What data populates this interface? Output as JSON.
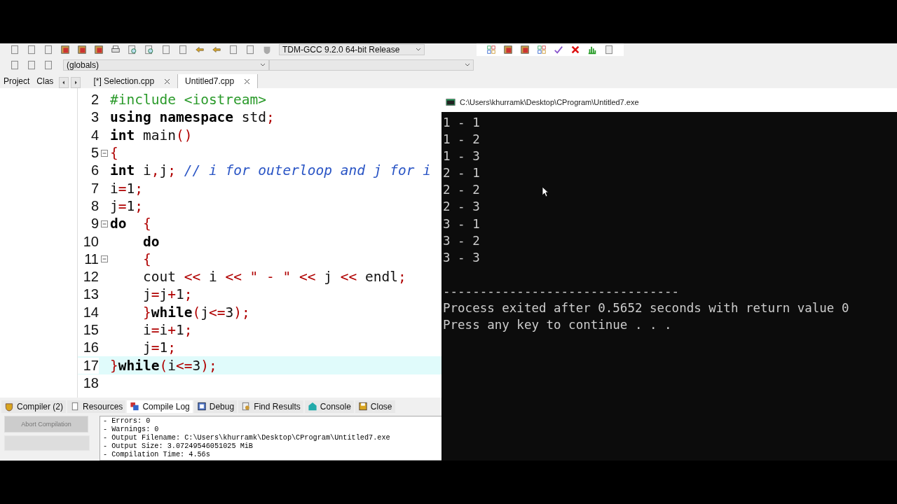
{
  "toolbar": {
    "compiler": "TDM-GCC 9.2.0 64-bit Release",
    "scope": "(globals)"
  },
  "side_tabs": [
    {
      "label": "Project"
    },
    {
      "label": "Clas"
    }
  ],
  "editor_tabs": [
    {
      "label": "[*] Selection.cpp",
      "selected": false
    },
    {
      "label": "Untitled7.cpp",
      "selected": true
    }
  ],
  "editor": {
    "lines": [
      {
        "number": "2",
        "fold": false,
        "highlighted": false,
        "tokens": [
          {
            "kind": "preproc",
            "text": "#include <iostream>"
          }
        ]
      },
      {
        "number": "3",
        "fold": false,
        "highlighted": false,
        "tokens": [
          {
            "kind": "keyword",
            "text": "using namespace"
          },
          {
            "kind": "plain",
            "text": " std"
          },
          {
            "kind": "symbol",
            "text": ";"
          }
        ]
      },
      {
        "number": "4",
        "fold": false,
        "highlighted": false,
        "tokens": [
          {
            "kind": "keyword",
            "text": "int"
          },
          {
            "kind": "plain",
            "text": " main"
          },
          {
            "kind": "symbol",
            "text": "()"
          }
        ]
      },
      {
        "number": "5",
        "fold": true,
        "highlighted": false,
        "tokens": [
          {
            "kind": "symbol",
            "text": "{"
          }
        ]
      },
      {
        "number": "6",
        "fold": false,
        "highlighted": false,
        "tokens": [
          {
            "kind": "keyword",
            "text": "int"
          },
          {
            "kind": "plain",
            "text": " i"
          },
          {
            "kind": "symbol",
            "text": ","
          },
          {
            "kind": "plain",
            "text": "j"
          },
          {
            "kind": "symbol",
            "text": "; "
          },
          {
            "kind": "comment",
            "text": "// i for outerloop and j for i"
          }
        ]
      },
      {
        "number": "7",
        "fold": false,
        "highlighted": false,
        "tokens": [
          {
            "kind": "plain",
            "text": "i"
          },
          {
            "kind": "symbol",
            "text": "="
          },
          {
            "kind": "plain",
            "text": "1"
          },
          {
            "kind": "symbol",
            "text": ";"
          }
        ]
      },
      {
        "number": "8",
        "fold": false,
        "highlighted": false,
        "tokens": [
          {
            "kind": "plain",
            "text": "j"
          },
          {
            "kind": "symbol",
            "text": "="
          },
          {
            "kind": "plain",
            "text": "1"
          },
          {
            "kind": "symbol",
            "text": ";"
          }
        ]
      },
      {
        "number": "9",
        "fold": true,
        "highlighted": false,
        "tokens": [
          {
            "kind": "keyword",
            "text": "do"
          },
          {
            "kind": "symbol",
            "text": "  {"
          }
        ]
      },
      {
        "number": "10",
        "fold": false,
        "highlighted": false,
        "tokens": [
          {
            "kind": "keyword",
            "text": "    do"
          }
        ]
      },
      {
        "number": "11",
        "fold": true,
        "highlighted": false,
        "tokens": [
          {
            "kind": "symbol",
            "text": "    {"
          }
        ]
      },
      {
        "number": "12",
        "fold": false,
        "highlighted": false,
        "tokens": [
          {
            "kind": "plain",
            "text": "    cout "
          },
          {
            "kind": "symbol",
            "text": "<<"
          },
          {
            "kind": "plain",
            "text": " i "
          },
          {
            "kind": "symbol",
            "text": "<< \" - \" <<"
          },
          {
            "kind": "plain",
            "text": " j "
          },
          {
            "kind": "symbol",
            "text": "<<"
          },
          {
            "kind": "plain",
            "text": " endl"
          },
          {
            "kind": "symbol",
            "text": ";"
          }
        ]
      },
      {
        "number": "13",
        "fold": false,
        "highlighted": false,
        "tokens": [
          {
            "kind": "plain",
            "text": "    j"
          },
          {
            "kind": "symbol",
            "text": "="
          },
          {
            "kind": "plain",
            "text": "j"
          },
          {
            "kind": "symbol",
            "text": "+"
          },
          {
            "kind": "plain",
            "text": "1"
          },
          {
            "kind": "symbol",
            "text": ";"
          }
        ]
      },
      {
        "number": "14",
        "fold": false,
        "highlighted": false,
        "tokens": [
          {
            "kind": "symbol",
            "text": "    }"
          },
          {
            "kind": "keyword",
            "text": "while"
          },
          {
            "kind": "symbol",
            "text": "("
          },
          {
            "kind": "plain",
            "text": "j"
          },
          {
            "kind": "symbol",
            "text": "<="
          },
          {
            "kind": "plain",
            "text": "3"
          },
          {
            "kind": "symbol",
            "text": ");"
          }
        ]
      },
      {
        "number": "15",
        "fold": false,
        "highlighted": false,
        "tokens": [
          {
            "kind": "plain",
            "text": "    i"
          },
          {
            "kind": "symbol",
            "text": "="
          },
          {
            "kind": "plain",
            "text": "i"
          },
          {
            "kind": "symbol",
            "text": "+"
          },
          {
            "kind": "plain",
            "text": "1"
          },
          {
            "kind": "symbol",
            "text": ";"
          }
        ]
      },
      {
        "number": "16",
        "fold": false,
        "highlighted": false,
        "tokens": [
          {
            "kind": "plain",
            "text": "    j"
          },
          {
            "kind": "symbol",
            "text": "="
          },
          {
            "kind": "plain",
            "text": "1"
          },
          {
            "kind": "symbol",
            "text": ";"
          }
        ]
      },
      {
        "number": "17",
        "fold": false,
        "highlighted": true,
        "tokens": [
          {
            "kind": "symbol",
            "text": "}"
          },
          {
            "kind": "keyword",
            "text": "while"
          },
          {
            "kind": "symbol",
            "text": "("
          },
          {
            "kind": "plain",
            "text": "i"
          },
          {
            "kind": "symbol",
            "text": "<="
          },
          {
            "kind": "plain",
            "text": "3"
          },
          {
            "kind": "symbol",
            "text": ");"
          }
        ]
      },
      {
        "number": "18",
        "fold": false,
        "highlighted": false
      }
    ]
  },
  "bottom_tabs": [
    {
      "label": "Compiler (2)",
      "kind": "compiler",
      "selected": false
    },
    {
      "label": "Resources",
      "kind": "resources",
      "selected": false
    },
    {
      "label": "Compile Log",
      "kind": "log",
      "selected": true
    },
    {
      "label": "Debug",
      "kind": "debug",
      "selected": false
    },
    {
      "label": "Find Results",
      "kind": "find",
      "selected": false
    },
    {
      "label": "Console",
      "kind": "console",
      "selected": false
    },
    {
      "label": "Close",
      "kind": "close",
      "selected": false
    }
  ],
  "abort_button": {
    "label": "Abort Compilation",
    "disabled": true
  },
  "compile_log": [
    "- Errors: 0",
    "- Warnings: 0",
    "- Output Filename: C:\\Users\\khurramk\\Desktop\\CProgram\\Untitled7.exe",
    "- Output Size: 3.07249546051025 MiB",
    "- Compilation Time: 4.56s"
  ],
  "console": {
    "title": "C:\\Users\\khurramk\\Desktop\\CProgram\\Untitled7.exe",
    "lines": [
      "1 - 1",
      "1 - 2",
      "1 - 3",
      "2 - 1",
      "2 - 2",
      "2 - 3",
      "3 - 1",
      "3 - 2",
      "3 - 3"
    ],
    "summary": [
      "--------------------------------",
      "Process exited after 0.5652 seconds with return value 0",
      "Press any key to continue . . ."
    ]
  }
}
